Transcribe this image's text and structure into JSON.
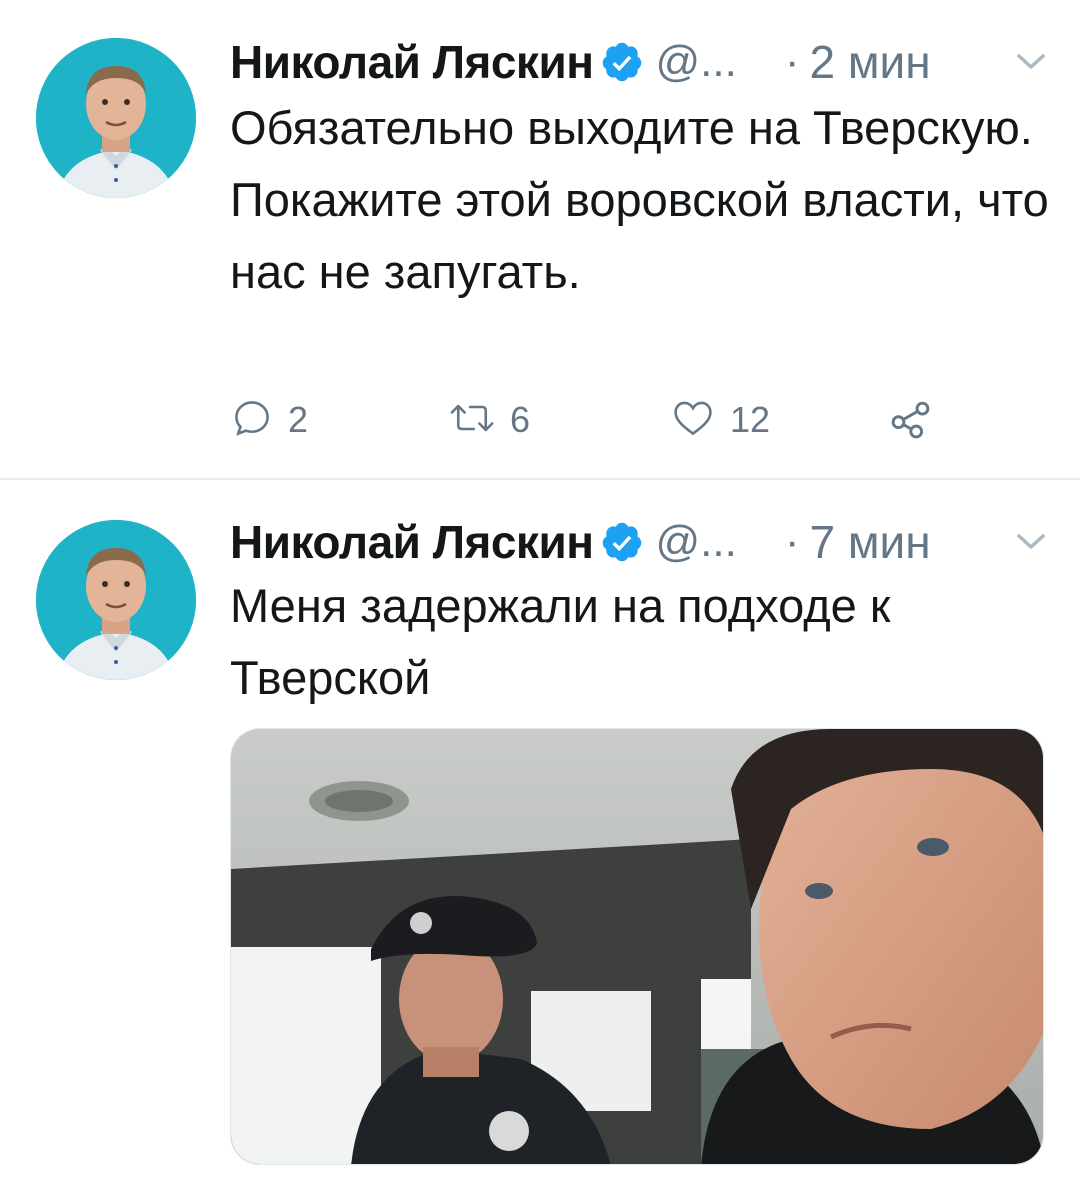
{
  "tweets": [
    {
      "author": {
        "display_name": "Николай Ляскин",
        "handle": "@...",
        "verified": true
      },
      "separator": "·",
      "time": "2 мин",
      "text": "Обязательно выходите на Тверскую. Покажите этой воровской власти, что нас не запугать.",
      "actions": {
        "replies": "2",
        "retweets": "6",
        "likes": "12"
      }
    },
    {
      "author": {
        "display_name": "Николай Ляскин",
        "handle": "@...",
        "verified": true
      },
      "separator": "·",
      "time": "7 мин",
      "text": "Меня задержали на подходе к Тверской",
      "media": {
        "type": "photo"
      }
    }
  ],
  "colors": {
    "text_primary": "#14171a",
    "text_secondary": "#657786",
    "verified_blue": "#1da1f2",
    "divider": "#e6ecf0",
    "avatar_bg": "#1fb3c8"
  },
  "icons": {
    "reply": "reply-icon",
    "retweet": "retweet-icon",
    "like": "heart-icon",
    "share": "share-icon",
    "caret": "chevron-down-icon",
    "verified": "verified-badge-icon"
  }
}
